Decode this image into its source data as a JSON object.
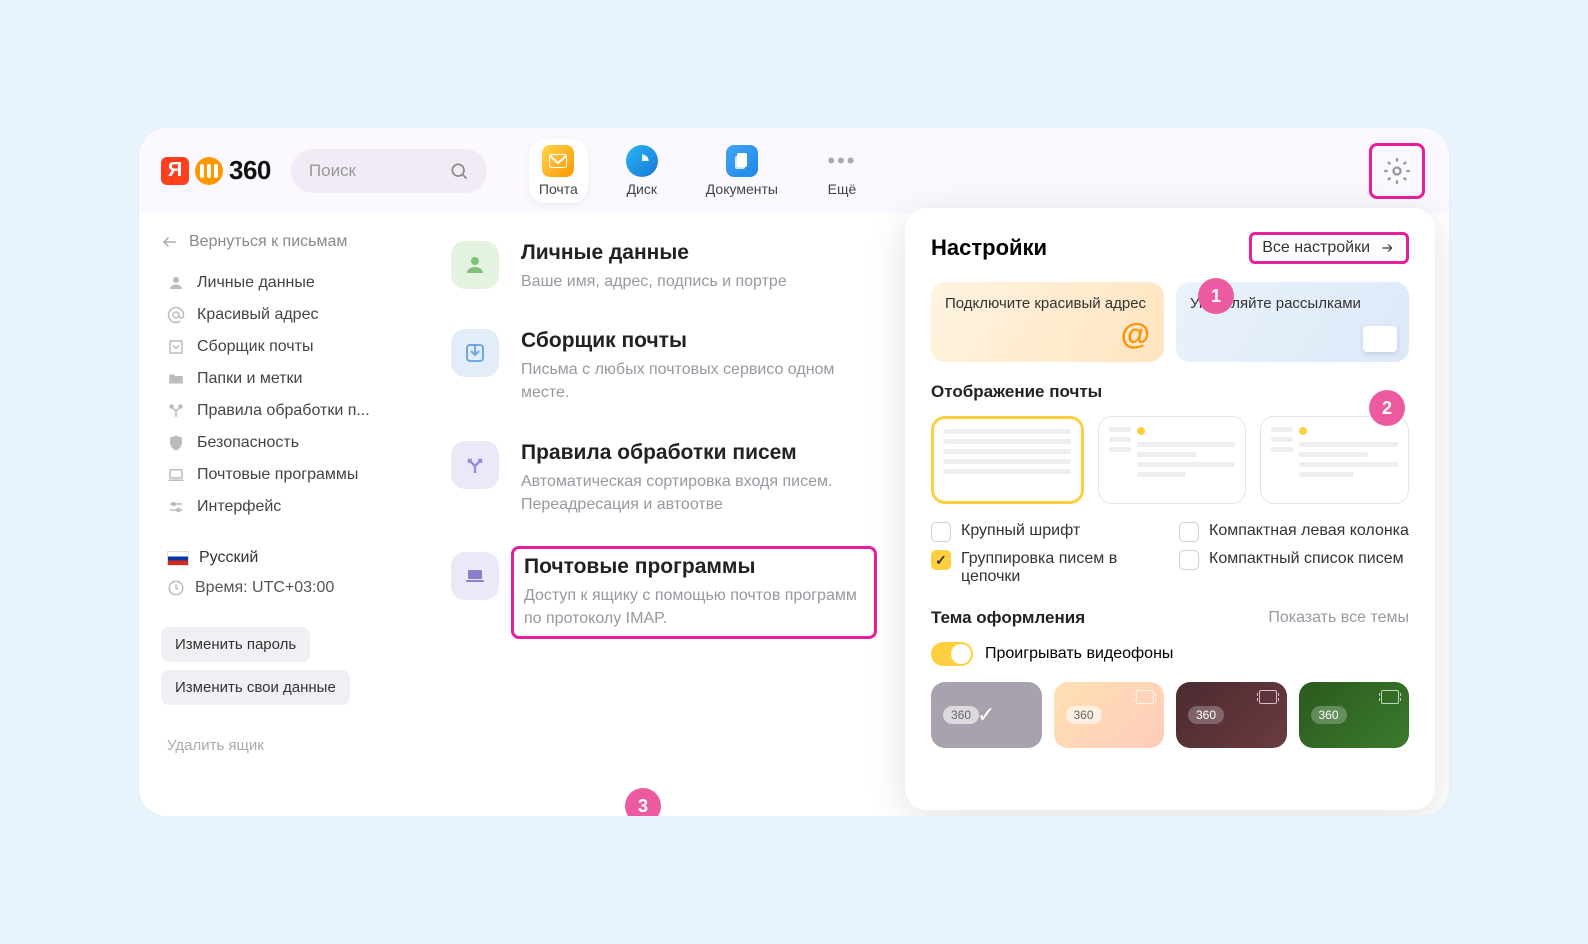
{
  "header": {
    "logo_text": "360",
    "search_placeholder": "Поиск",
    "services": [
      {
        "id": "mail",
        "label": "Почта"
      },
      {
        "id": "disk",
        "label": "Диск"
      },
      {
        "id": "docs",
        "label": "Документы"
      },
      {
        "id": "more",
        "label": "Ещё"
      }
    ]
  },
  "sidebar": {
    "back": "Вернуться к письмам",
    "items": [
      "Личные данные",
      "Красивый адрес",
      "Сборщик почты",
      "Папки и метки",
      "Правила обработки п...",
      "Безопасность",
      "Почтовые программы",
      "Интерфейс"
    ],
    "language": "Русский",
    "time": "Время: UTC+03:00",
    "change_password": "Изменить пароль",
    "change_data": "Изменить свои данные",
    "delete_mailbox": "Удалить ящик"
  },
  "main": {
    "cards": [
      {
        "title": "Личные данные",
        "desc": "Ваше имя, адрес, подпись и портре"
      },
      {
        "title": "Сборщик почты",
        "desc": "Письма с любых почтовых сервисо одном месте."
      },
      {
        "title": "Правила обработки писем",
        "desc": "Автоматическая сортировка входя писем. Переадресация и автоотве"
      },
      {
        "title": "Почтовые программы",
        "desc": "Доступ к ящику с помощью почтов программ по протоколу IMAP."
      }
    ]
  },
  "popover": {
    "title": "Настройки",
    "all_settings": "Все настройки",
    "promo1": "Подключите красивый адрес",
    "promo2": "Управляйте рассылками",
    "section_display": "Отображение почты",
    "checks": {
      "large_font": "Крупный шрифт",
      "compact_left": "Компактная левая колонка",
      "group_threads": "Группировка писем в цепочки",
      "compact_list": "Компактный список писем"
    },
    "section_theme": "Тема оформления",
    "show_all_themes": "Показать все темы",
    "play_video": "Проигрывать видеофоны",
    "theme_tag": "360"
  },
  "badges": {
    "b1": "1",
    "b2": "2",
    "b3": "3"
  }
}
